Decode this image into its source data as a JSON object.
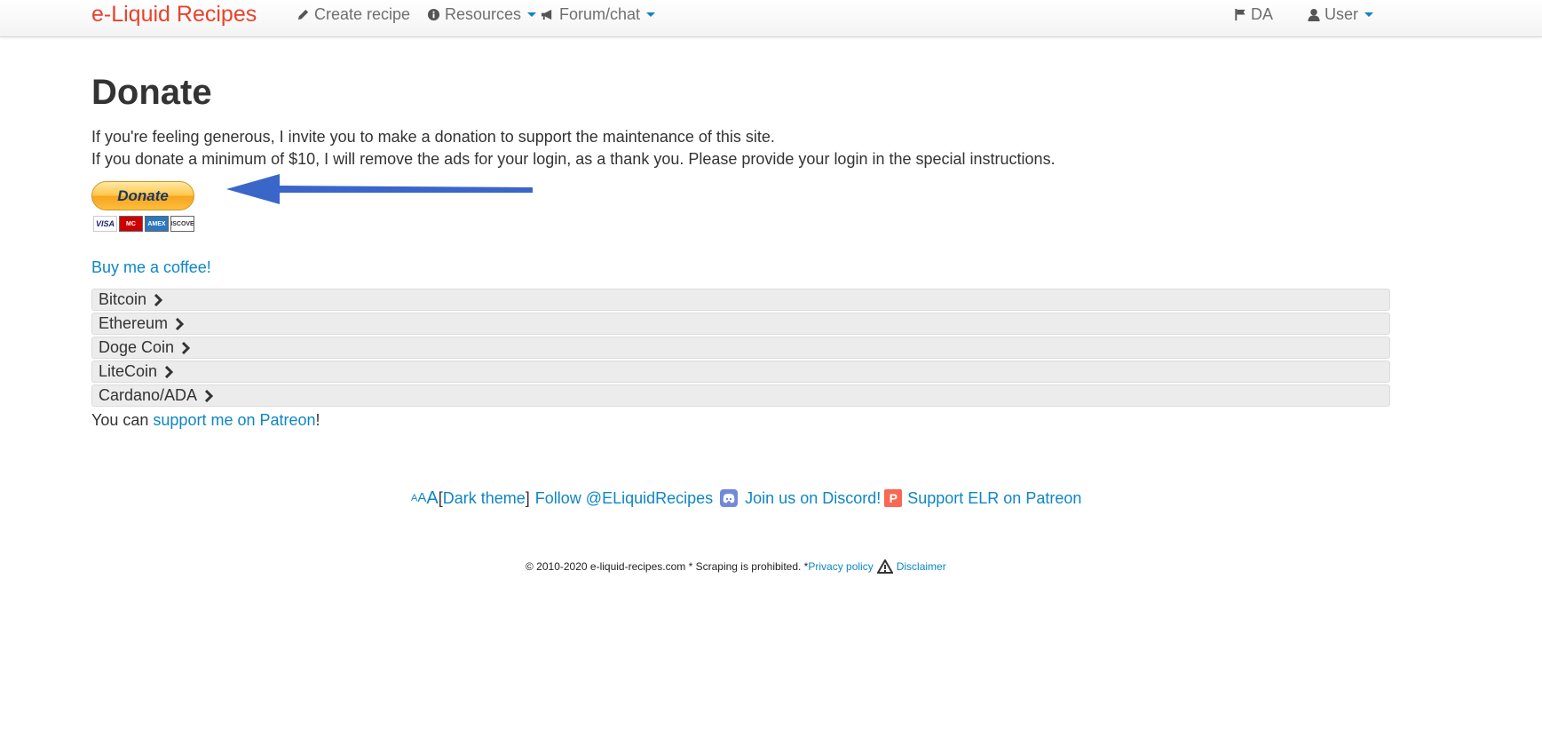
{
  "nav": {
    "brand": "e-Liquid Recipes",
    "create_recipe": "Create recipe",
    "resources": "Resources",
    "forum": "Forum/chat",
    "language": "DA",
    "user": "User",
    "icons": [
      "pencil-icon",
      "info-icon",
      "megaphone-icon",
      "flag-icon",
      "user-icon"
    ]
  },
  "main": {
    "title": "Donate",
    "intro_line1": "If you're feeling generous, I invite you to make a donation to support the maintenance of this site.",
    "intro_line2": "If you donate a minimum of $10, I will remove the ads for your login, as a thank you. Please provide your login in the special instructions.",
    "donate_button": "Donate",
    "cards": [
      "VISA",
      "MC",
      "AMEX",
      "DISCOVER"
    ],
    "coffee_link": "Buy me a coffee!",
    "crypto": [
      {
        "label": "Bitcoin"
      },
      {
        "label": "Ethereum"
      },
      {
        "label": "Doge Coin"
      },
      {
        "label": "LiteCoin"
      },
      {
        "label": "Cardano/ADA"
      }
    ],
    "patreon_prefix": "You can ",
    "patreon_link": "support me on Patreon",
    "patreon_suffix": "!"
  },
  "footer": {
    "aaa_small": "A",
    "aaa_mid": "A",
    "aaa_big": "A",
    "bracket_open": " [",
    "dark_theme": "Dark theme",
    "bracket_close": "]",
    "follow": "Follow @ELiquidRecipes",
    "discord": "Join us on Discord!",
    "patreon_icon_letter": "P",
    "patreon": "Support ELR on Patreon",
    "copyright": "© 2010-2020 e-liquid-recipes.com * Scraping is prohibited. * ",
    "privacy": "Privacy policy",
    "disclaimer": "Disclaimer"
  },
  "colors": {
    "brand": "#e8432b",
    "link": "#0e86c4",
    "arrow": "#3a66c9",
    "accordion_bg": "#ececec"
  }
}
